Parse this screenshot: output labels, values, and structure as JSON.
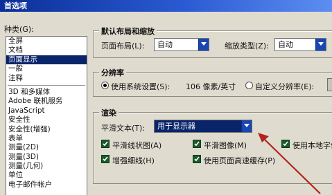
{
  "window": {
    "title": "首选项"
  },
  "categories": {
    "label": "种类(G):",
    "top_items": [
      {
        "label": "全屏",
        "selected": false
      },
      {
        "label": "文档",
        "selected": false
      },
      {
        "label": "页面显示",
        "selected": true
      },
      {
        "label": "一般",
        "selected": false
      },
      {
        "label": "注释",
        "selected": false
      }
    ],
    "items": [
      "3D 和多媒体",
      "Adobe 联机服务",
      "JavaScript",
      "安全性",
      "安全性(增强)",
      "表单",
      "测量(2D)",
      "测量(3D)",
      "测量(几何)",
      "单位",
      "电子邮件帐户"
    ]
  },
  "default_layout": {
    "title": "默认布局和缩放",
    "page_layout_label": "页面布局(L):",
    "page_layout_value": "自动",
    "zoom_label": "缩放类型(Z):",
    "zoom_value": "自动"
  },
  "resolution": {
    "title": "分辨率",
    "system_label": "使用系统设置(S):",
    "system_value": "106 像素/英寸",
    "custom_label": "自定义分辨率(E):",
    "selected": "system"
  },
  "rendering": {
    "title": "渲染",
    "smooth_text_label": "平滑文本(T):",
    "smooth_text_value": "用于显示器",
    "checkboxes": [
      {
        "label": "平滑线状图(A)",
        "checked": true
      },
      {
        "label": "平滑图像(M)",
        "checked": true
      },
      {
        "label": "使用本地字体",
        "checked": true
      },
      {
        "label": "增强细线(H)",
        "checked": true
      },
      {
        "label": "使用页面高速缓存(P)",
        "checked": true
      }
    ]
  },
  "colors": {
    "arrow": "#b0241c",
    "title_bar": "#0a2f98",
    "selection": "#0a246a",
    "checkbox": "#1b5a2a"
  },
  "icons": {
    "dropdown": "chevron-down-icon",
    "check": "check-icon",
    "annotation": "arrow-annotation"
  }
}
